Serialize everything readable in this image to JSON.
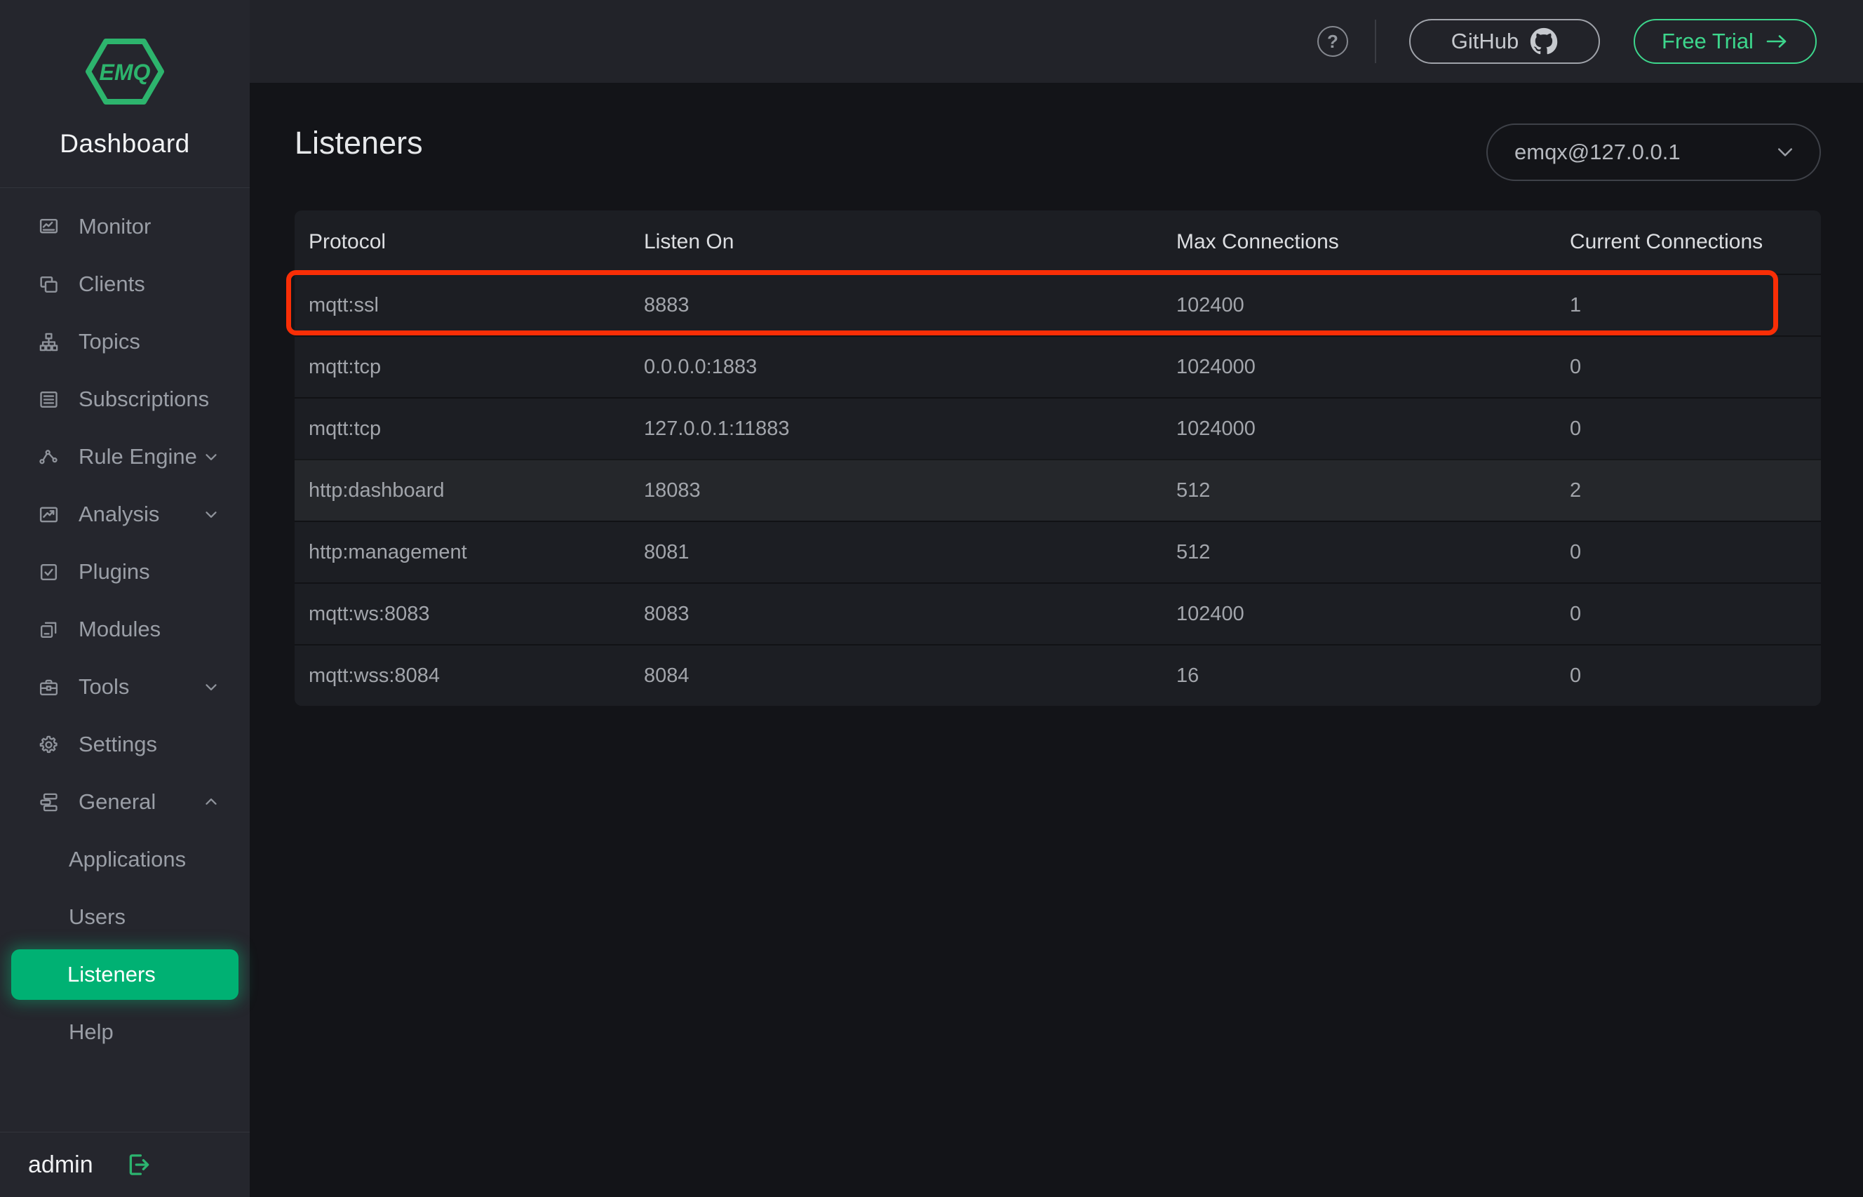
{
  "app": {
    "logo_text": "EMQ",
    "title": "Dashboard"
  },
  "topbar": {
    "help_glyph": "?",
    "github_label": "GitHub",
    "free_trial_label": "Free Trial"
  },
  "sidebar": {
    "items": [
      {
        "label": "Monitor"
      },
      {
        "label": "Clients"
      },
      {
        "label": "Topics"
      },
      {
        "label": "Subscriptions"
      },
      {
        "label": "Rule Engine",
        "chevron": "down"
      },
      {
        "label": "Analysis",
        "chevron": "down"
      },
      {
        "label": "Plugins"
      },
      {
        "label": "Modules"
      },
      {
        "label": "Tools",
        "chevron": "down"
      },
      {
        "label": "Settings"
      },
      {
        "label": "General",
        "chevron": "up"
      }
    ],
    "submenu": [
      {
        "label": "Applications"
      },
      {
        "label": "Users"
      },
      {
        "label": "Listeners",
        "active": true
      },
      {
        "label": "Help"
      }
    ],
    "user": "admin"
  },
  "main": {
    "title": "Listeners",
    "node_selector": "emqx@127.0.0.1",
    "table": {
      "columns": [
        "Protocol",
        "Listen On",
        "Max Connections",
        "Current Connections"
      ],
      "rows": [
        [
          "mqtt:ssl",
          "8883",
          "102400",
          "1"
        ],
        [
          "mqtt:tcp",
          "0.0.0.0:1883",
          "1024000",
          "0"
        ],
        [
          "mqtt:tcp",
          "127.0.0.1:11883",
          "1024000",
          "0"
        ],
        [
          "http:dashboard",
          "18083",
          "512",
          "2"
        ],
        [
          "http:management",
          "8081",
          "512",
          "0"
        ],
        [
          "mqtt:ws:8083",
          "8083",
          "102400",
          "0"
        ],
        [
          "mqtt:wss:8084",
          "8084",
          "16",
          "0"
        ]
      ],
      "highlighted_row": 0
    }
  },
  "colors": {
    "accent_green": "#00b173",
    "logo_green": "#2db46d",
    "free_trial_green": "#3dd68c",
    "highlight_red": "#f92e06"
  }
}
